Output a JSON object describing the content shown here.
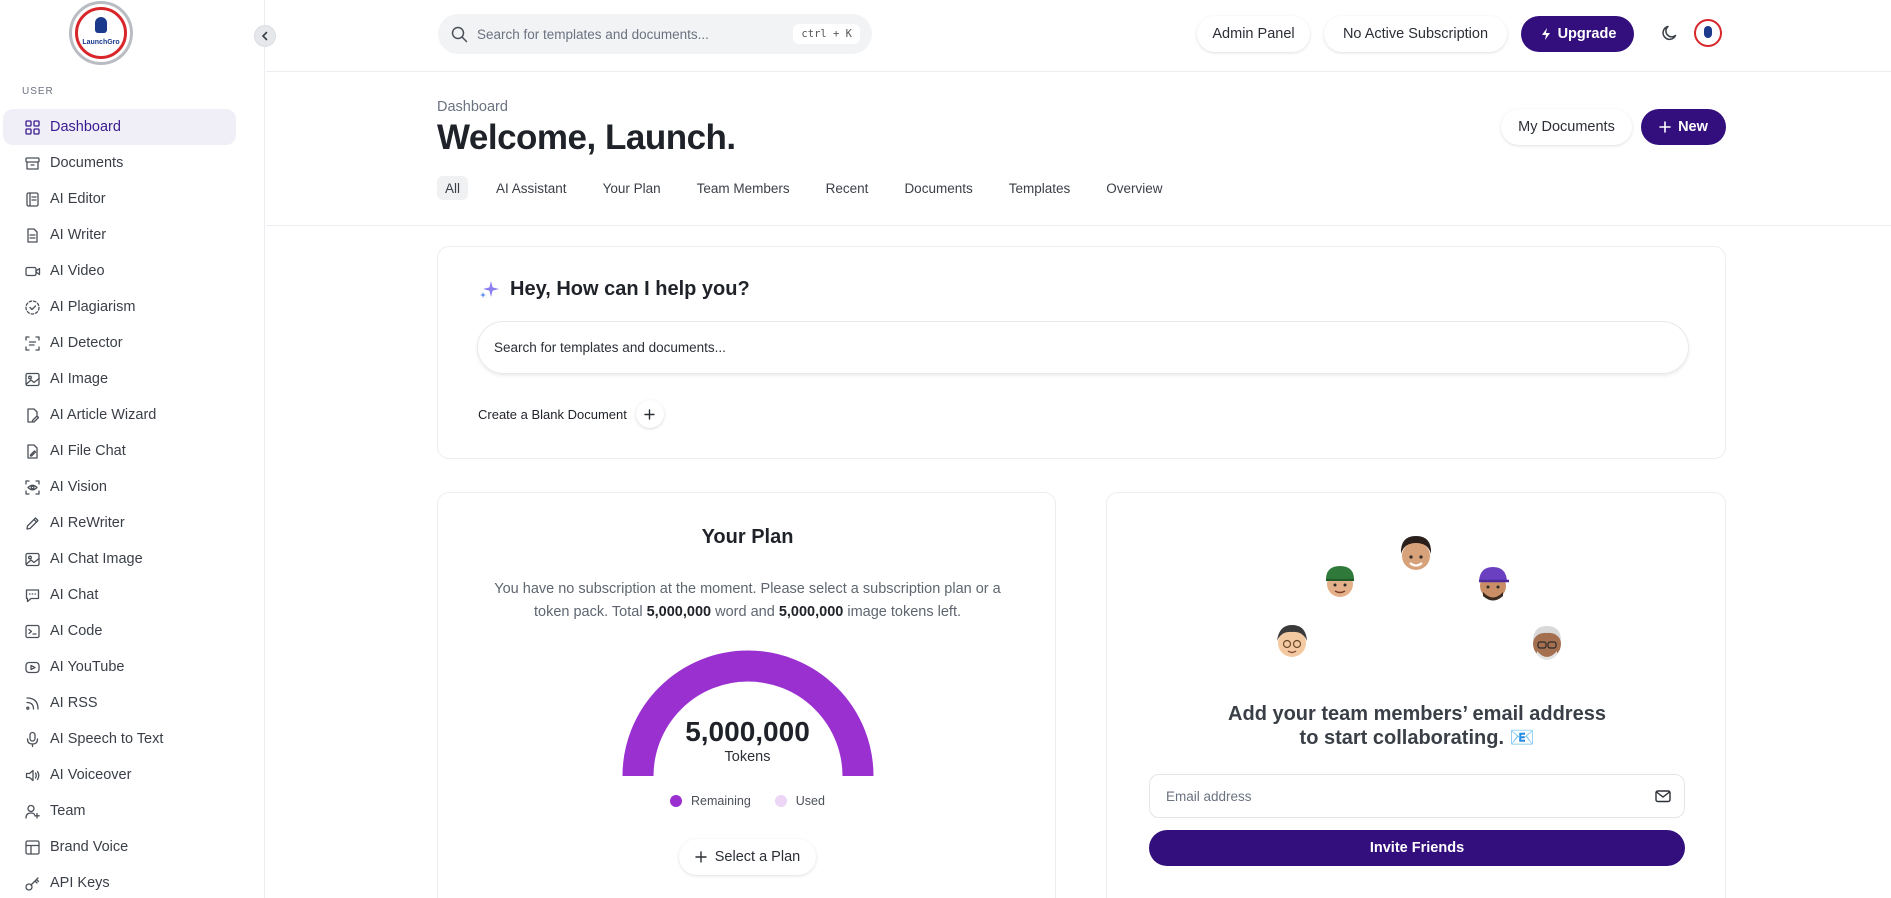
{
  "app": {
    "logo_text": "LaunchGro",
    "colors": {
      "accent": "#330f7e",
      "gauge": "#9b30d0",
      "gauge_used": "#ecd5f5"
    }
  },
  "sidebar": {
    "section_label": "USER",
    "items": [
      {
        "label": "Dashboard",
        "icon": "grid-icon",
        "active": true
      },
      {
        "label": "Documents",
        "icon": "archive-icon"
      },
      {
        "label": "AI Editor",
        "icon": "notebook-icon"
      },
      {
        "label": "AI Writer",
        "icon": "document-icon"
      },
      {
        "label": "AI Video",
        "icon": "video-icon"
      },
      {
        "label": "AI Plagiarism",
        "icon": "dashed-check-icon"
      },
      {
        "label": "AI Detector",
        "icon": "scan-text-icon"
      },
      {
        "label": "AI Image",
        "icon": "image-icon"
      },
      {
        "label": "AI Article Wizard",
        "icon": "file-edit-icon"
      },
      {
        "label": "AI File Chat",
        "icon": "file-pen-icon"
      },
      {
        "label": "AI Vision",
        "icon": "eye-scan-icon"
      },
      {
        "label": "AI ReWriter",
        "icon": "pencil-icon"
      },
      {
        "label": "AI Chat Image",
        "icon": "image-icon"
      },
      {
        "label": "AI Chat",
        "icon": "chat-icon"
      },
      {
        "label": "AI Code",
        "icon": "terminal-icon"
      },
      {
        "label": "AI YouTube",
        "icon": "youtube-icon"
      },
      {
        "label": "AI RSS",
        "icon": "rss-icon"
      },
      {
        "label": "AI Speech to Text",
        "icon": "microphone-icon"
      },
      {
        "label": "AI Voiceover",
        "icon": "speaker-icon"
      },
      {
        "label": "Team",
        "icon": "user-plus-icon"
      },
      {
        "label": "Brand Voice",
        "icon": "layout-icon"
      },
      {
        "label": "API Keys",
        "icon": "key-icon"
      }
    ]
  },
  "topbar": {
    "search_placeholder": "Search for templates and documents...",
    "shortcut": "ctrl + K",
    "admin_panel": "Admin Panel",
    "subscription": "No Active Subscription",
    "upgrade": "Upgrade"
  },
  "header": {
    "breadcrumb": "Dashboard",
    "title": "Welcome, Launch.",
    "my_documents": "My Documents",
    "new_label": "New",
    "tabs": [
      {
        "label": "All",
        "active": true
      },
      {
        "label": "AI Assistant"
      },
      {
        "label": "Your Plan"
      },
      {
        "label": "Team Members"
      },
      {
        "label": "Recent"
      },
      {
        "label": "Documents"
      },
      {
        "label": "Templates"
      },
      {
        "label": "Overview"
      }
    ]
  },
  "assistant": {
    "title": "Hey, How can I help you?",
    "search_placeholder": "Search for templates and documents...",
    "blank_document": "Create a Blank Document"
  },
  "plan": {
    "title": "Your Plan",
    "desc_prefix": "You have no subscription at the moment. Please select a subscription plan or a token pack. Total ",
    "word_tokens": "5,000,000",
    "desc_middle": " word and ",
    "image_tokens": "5,000,000",
    "desc_suffix": " image tokens left.",
    "gauge_value": "5,000,000",
    "gauge_unit": "Tokens",
    "remaining_fraction": 1.0,
    "legend_remaining": "Remaining",
    "legend_used": "Used",
    "select_plan": "Select a Plan"
  },
  "team": {
    "title_line1": "Add your team members’ email address",
    "title_line2": "to start collaborating. 📧",
    "email_placeholder": "Email address",
    "invite_button": "Invite Friends"
  }
}
